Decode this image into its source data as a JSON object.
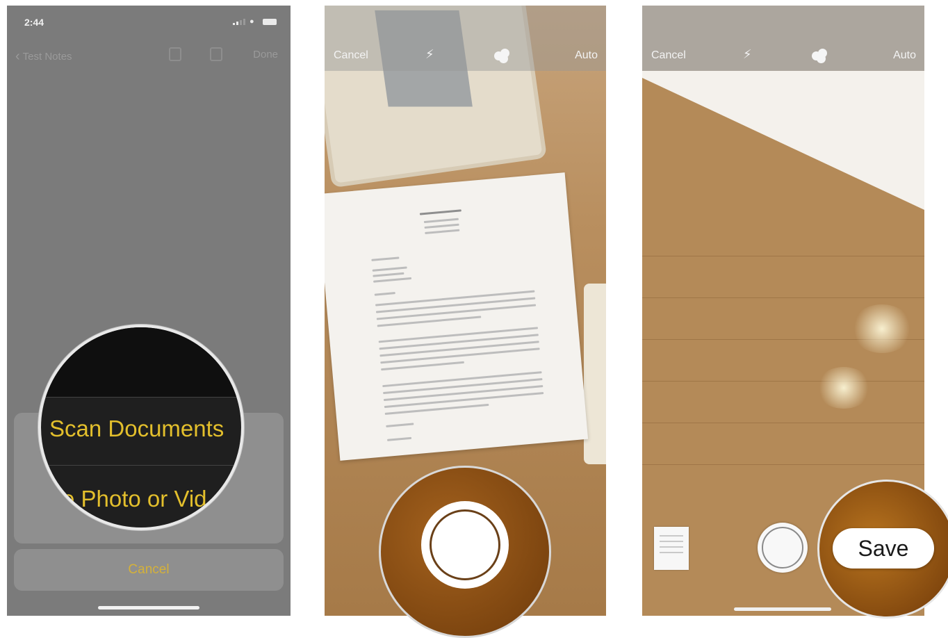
{
  "panel1": {
    "status_time": "2:44",
    "nav_back_label": "Test Notes",
    "nav_done_label": "Done",
    "magnifier": {
      "option_scan": "Scan Documents",
      "option_photo": "e Photo or Vid"
    },
    "sheet_cancel_label": "Cancel",
    "accent_color": "#d4b13a"
  },
  "panel2": {
    "cancel_label": "Cancel",
    "mode_label": "Auto",
    "icons": [
      "flash-icon",
      "filter-icon",
      "shutter-button"
    ]
  },
  "panel3": {
    "cancel_label": "Cancel",
    "mode_label": "Auto",
    "save_label": "Save",
    "icons": [
      "flash-icon",
      "filter-icon",
      "scan-thumbnail",
      "shutter-button"
    ]
  }
}
